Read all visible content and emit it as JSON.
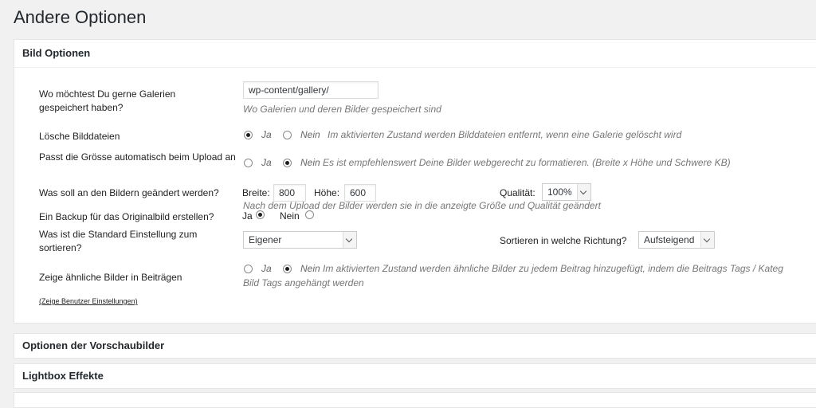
{
  "page_title": "Andere Optionen",
  "sections": {
    "bild": "Bild Optionen",
    "vorschau": "Optionen der Vorschaubilder",
    "lightbox": "Lightbox Effekte"
  },
  "gallery_path": {
    "label": "Wo möchtest Du gerne Galerien gespeichert haben?",
    "value": "wp-content/gallery/",
    "desc": "Wo Galerien und deren Bilder gespeichert sind"
  },
  "delete_files": {
    "label": "Lösche Bilddateien",
    "yes": "Ja",
    "no": "Nein",
    "selected": "yes",
    "desc": "Im aktivierten Zustand werden Bilddateien entfernt, wenn eine Galerie gelöscht wird"
  },
  "auto_resize": {
    "label": "Passt die Grösse automatisch beim Upload an",
    "yes": "Ja",
    "no": "Nein",
    "selected": "no",
    "desc": "Es ist empfehlenswert Deine Bilder webgerecht zu formatieren. (Breite x Höhe und Schwere KB)"
  },
  "resize": {
    "label": "Was soll an den Bildern geändert werden?",
    "width_label": "Breite:",
    "width_value": "800",
    "height_label": "Höhe:",
    "height_value": "600",
    "quality_label": "Qualität:",
    "quality_value": "100%",
    "desc": "Nach dem Upload der Bilder werden sie in die anzeigte Größe und Qualität geändert"
  },
  "backup": {
    "label": "Ein Backup für das Originalbild erstellen?",
    "yes": "Ja",
    "no": "Nein",
    "selected": "yes"
  },
  "sort": {
    "label": "Was ist die Standard Einstellung zum sortieren?",
    "value": "Eigener",
    "direction_label": "Sortieren in welche Richtung?",
    "direction_value": "Aufsteigend"
  },
  "related": {
    "label": "Zeige ähnliche Bilder in Beiträgen",
    "yes": "Ja",
    "no": "Nein",
    "selected": "no",
    "desc_line1": "Im aktivierten Zustand werden ähnliche Bilder zu jedem Beitrag hinzugefügt, indem die Beitrags Tags / Kateg",
    "desc_line2": "Bild Tags angehängt werden"
  },
  "user_settings_link": "(Zeige Benutzer Einstellungen)"
}
